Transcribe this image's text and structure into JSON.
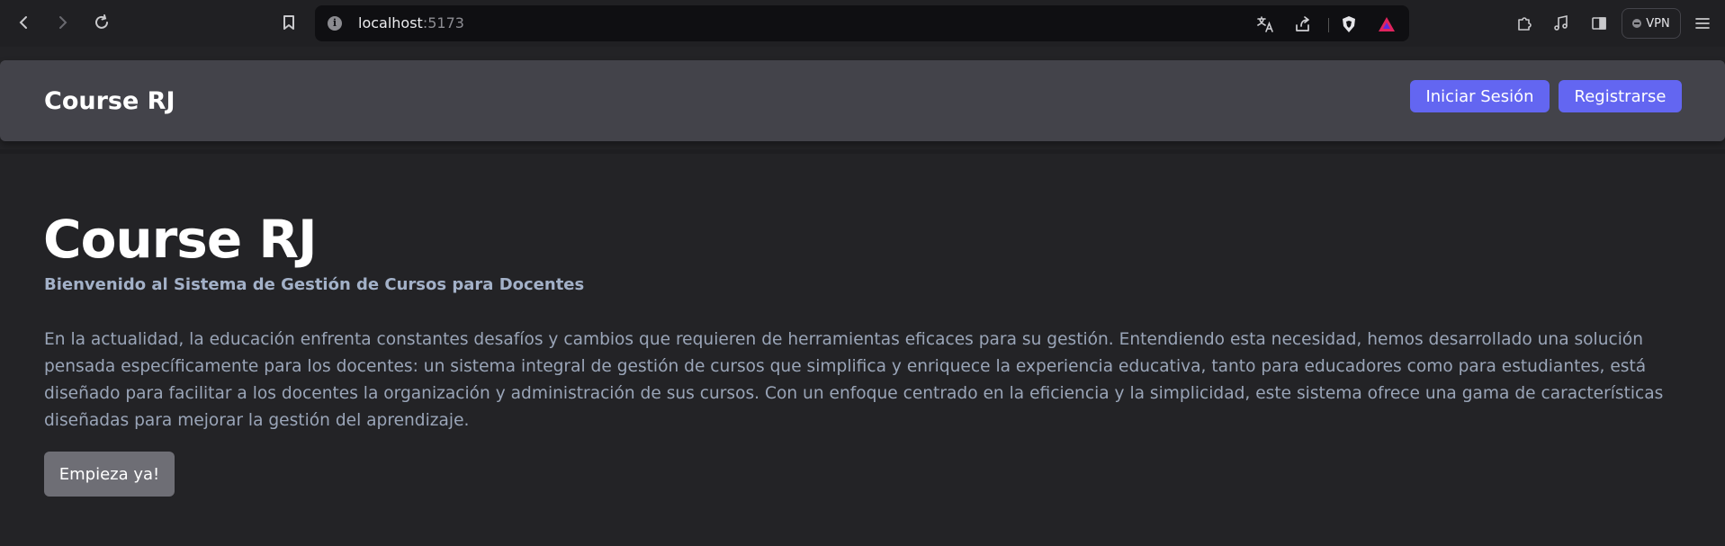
{
  "browser": {
    "url_host": "localhost",
    "url_port": ":5173",
    "vpn_label": "VPN",
    "icons": [
      "back-icon",
      "forward-icon",
      "reload-icon",
      "bookmark-icon",
      "info-icon",
      "translate-icon",
      "share-icon",
      "brave-shield-icon",
      "brave-rewards-icon",
      "extensions-icon",
      "media-icon",
      "sidebar-icon",
      "menu-icon"
    ]
  },
  "header": {
    "brand": "Course RJ",
    "login_label": "Iniciar Sesión",
    "register_label": "Registrarse"
  },
  "hero": {
    "title": "Course RJ",
    "subtitle": "Bienvenido al Sistema de Gestión de Cursos para Docentes",
    "body": "En la actualidad, la educación enfrenta constantes desafíos y cambios que requieren de herramientas eficaces para su gestión. Entendiendo esta necesidad, hemos desarrollado una solución pensada específicamente para los docentes: un sistema integral de gestión de cursos que simplifica y enriquece la experiencia educativa, tanto para educadores como para estudiantes, está diseñado para facilitar a los docentes la organización y administración de sus cursos. Con un enfoque centrado en la eficiencia y la simplicidad, este sistema ofrece una gama de características diseñadas para mejorar la gestión del aprendizaje.",
    "cta_label": "Empieza ya!"
  },
  "colors": {
    "accent": "#6366f1",
    "header_bg": "#43434a",
    "page_bg": "#232326",
    "cta_bg": "#6e6e75"
  }
}
